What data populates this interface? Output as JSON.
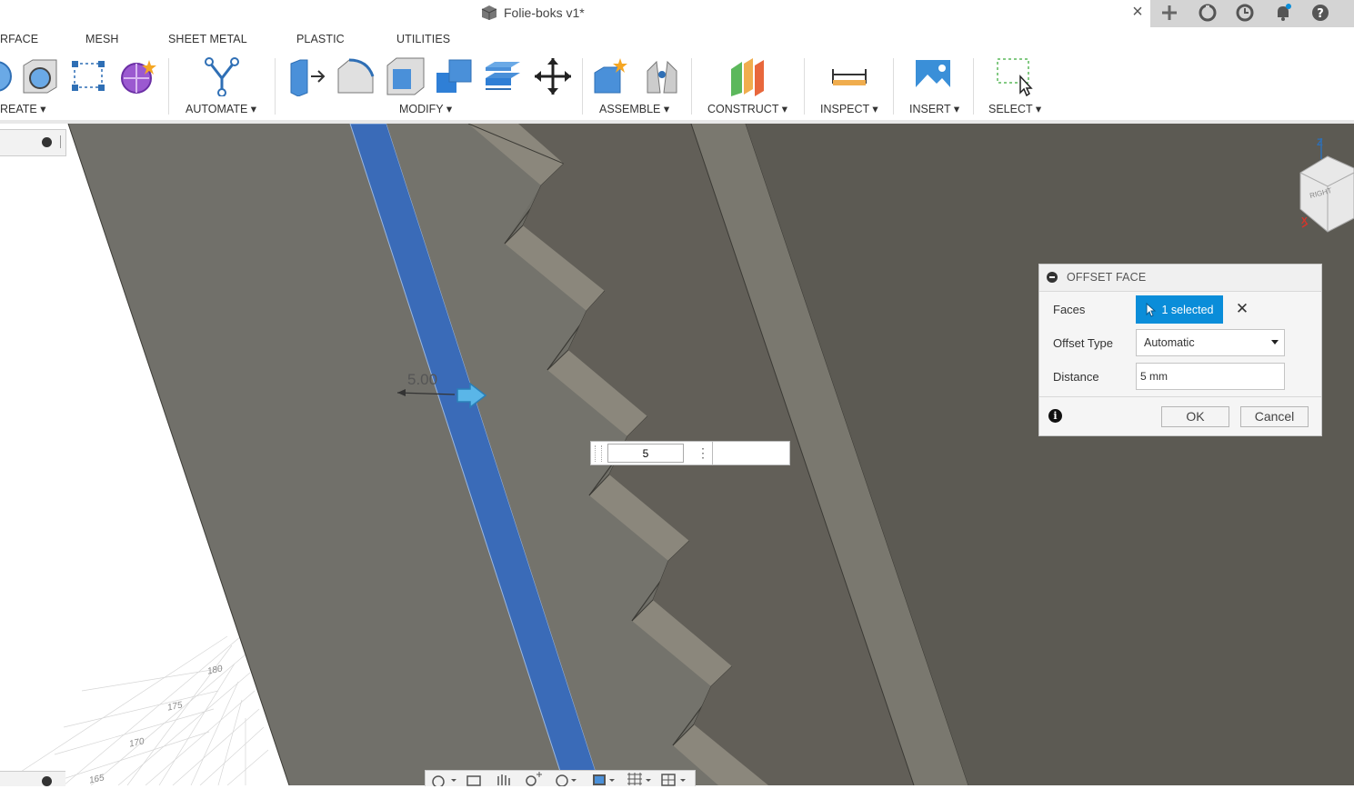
{
  "window": {
    "title": "Folie-boks v1*"
  },
  "tabs": [
    "RFACE",
    "MESH",
    "SHEET METAL",
    "PLASTIC",
    "UTILITIES"
  ],
  "groups": {
    "create": "REATE",
    "automate": "AUTOMATE",
    "modify": "MODIFY",
    "assemble": "ASSEMBLE",
    "construct": "CONSTRUCT",
    "inspect": "INSPECT",
    "insert": "INSERT",
    "select": "SELECT"
  },
  "viewport": {
    "dimension_label": "5.00",
    "inline_value": "5",
    "ruler_ticks": [
      "180",
      "175",
      "170",
      "165"
    ],
    "viewcube_face": "RIGHT",
    "axis_z": "Z",
    "axis_x": "X"
  },
  "dialog": {
    "title": "OFFSET FACE",
    "faces_label": "Faces",
    "faces_value": "1 selected",
    "offset_type_label": "Offset Type",
    "offset_type_value": "Automatic",
    "distance_label": "Distance",
    "distance_value": "5 mm",
    "ok": "OK",
    "cancel": "Cancel"
  },
  "colors": {
    "accent": "#0a8dd9",
    "selected_face": "#3a6bb8",
    "model_dark": "#5f5e57",
    "model_light": "#76756e"
  }
}
